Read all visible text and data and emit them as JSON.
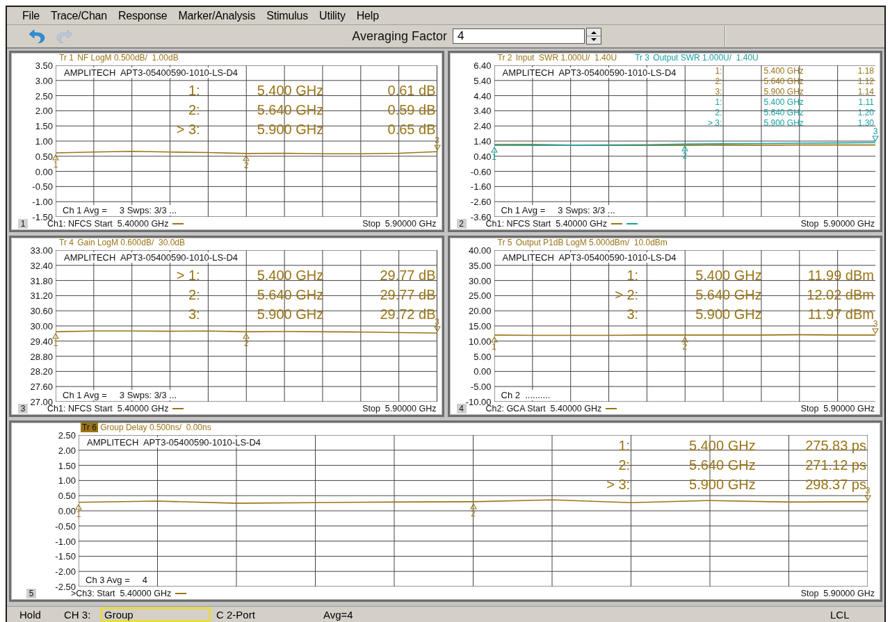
{
  "menu": [
    "File",
    "Trace/Chan",
    "Response",
    "Marker/Analysis",
    "Stimulus",
    "Utility",
    "Help"
  ],
  "toolbar": {
    "undo": {
      "disabled": false
    },
    "redo": {
      "disabled": true
    },
    "field_label": "Averaging Factor",
    "field_value": "4"
  },
  "panels": [
    {
      "number": "1",
      "traces": [
        {
          "description": "NF LogM 0.500dB/  1.00dB",
          "color": "#9a7416",
          "selected": false
        }
      ],
      "title": "AMPLITECH  APT3-05400590-1010-LS-D4",
      "readouts": [
        {
          "label": "1:",
          "frequency": "5.400 GHz",
          "value": "0.61 dB",
          "color": "#9a7416"
        },
        {
          "label": "2:",
          "frequency": "5.640 GHz",
          "value": "0.59 dB",
          "color": "#9a7416"
        },
        {
          "label": "> 3:",
          "frequency": "5.900 GHz",
          "value": "0.65 dB",
          "color": "#9a7416"
        }
      ],
      "markers": [
        {
          "text": "1"
        },
        {
          "text": "2"
        },
        {
          "text": "3"
        }
      ],
      "channel_status": "Ch 1 Avg =     3 Swps: 3/3 ...",
      "start": "Ch1: NFCS Start  5.40000 GHz",
      "stop": "Stop  5.90000 GHz",
      "chart_data": {
        "type": "line",
        "categories": [
          null,
          null,
          null,
          null,
          null,
          null,
          null,
          null,
          null,
          null,
          null
        ],
        "ylim": [
          -1.5,
          3.5
        ],
        "grid": true,
        "yticks": [
          {
            "value": 3.5,
            "label": "3.50"
          },
          {
            "value": 3,
            "label": "3.00"
          },
          {
            "value": 2.5,
            "label": "2.50"
          },
          {
            "value": 2,
            "label": "2.00"
          },
          {
            "value": 1.5,
            "label": "1.50"
          },
          {
            "value": 1,
            "label": "1.00"
          },
          {
            "value": 0.5,
            "label": "0.50"
          },
          {
            "value": 0,
            "label": "0.00"
          },
          {
            "value": -0.5,
            "label": "-0.50"
          },
          {
            "value": -1,
            "label": "-1.00"
          },
          {
            "value": -1.5,
            "label": "-1.50"
          }
        ],
        "series": [
          {
            "name": "Tr 1",
            "color": "#9a7416",
            "values": [
              0.61,
              0.64,
              0.66,
              0.64,
              0.62,
              0.59,
              0.6,
              0.58,
              0.58,
              0.6,
              0.65
            ]
          }
        ]
      }
    },
    {
      "number": "2",
      "traces": [
        {
          "description": "Input  SWR 1.000U/  1.40U",
          "color": "#9a7416",
          "selected": false
        },
        {
          "description": "Output SWR 1.000U/  1.40U",
          "color": "#1aa0a0",
          "selected": false
        }
      ],
      "title": "AMPLITECH  APT3-05400590-1010-LS-D4",
      "readouts": [
        {
          "label": "1:",
          "frequency": "5.400 GHz",
          "value": "1.18",
          "color": "#9a7416"
        },
        {
          "label": "2:",
          "frequency": "5.640 GHz",
          "value": "1.12",
          "color": "#9a7416"
        },
        {
          "label": "3:",
          "frequency": "5.900 GHz",
          "value": "1.14",
          "color": "#9a7416"
        },
        {
          "label": "1:",
          "frequency": "5.400 GHz",
          "value": "1.11",
          "color": "#1aa0a0"
        },
        {
          "label": "2:",
          "frequency": "5.640 GHz",
          "value": "1.20",
          "color": "#1aa0a0"
        },
        {
          "label": "> 3:",
          "frequency": "5.900 GHz",
          "value": "1.30",
          "color": "#1aa0a0"
        }
      ],
      "markers": [
        {
          "text": "1"
        },
        {
          "text": "2"
        },
        {
          "text": "3"
        }
      ],
      "channel_status": "Ch 1 Avg =     3 Swps: 3/3 ...",
      "start": "Ch1: NFCS Start  5.40000 GHz",
      "stop": "Stop  5.90000 GHz",
      "chart_data": {
        "type": "line",
        "categories": [
          null,
          null,
          null,
          null,
          null,
          null,
          null,
          null,
          null,
          null,
          null
        ],
        "ylim": [
          -3.6,
          6.4
        ],
        "grid": true,
        "yticks": [
          {
            "value": 6.4,
            "label": "6.40"
          },
          {
            "value": 5.4,
            "label": "5.40"
          },
          {
            "value": 4.4,
            "label": "4.40"
          },
          {
            "value": 3.4,
            "label": "3.40"
          },
          {
            "value": 2.4,
            "label": "2.40"
          },
          {
            "value": 1.4,
            "label": "1.40"
          },
          {
            "value": 0.4,
            "label": "0.40"
          },
          {
            "value": -0.6,
            "label": "-0.60"
          },
          {
            "value": -1.6,
            "label": "-1.60"
          },
          {
            "value": -2.6,
            "label": "-2.60"
          },
          {
            "value": -3.6,
            "label": "-3.60"
          }
        ],
        "series": [
          {
            "name": "Tr 2",
            "color": "#9a7416",
            "values": [
              1.18,
              1.18,
              1.13,
              1.12,
              1.12,
              1.12,
              1.13,
              1.13,
              1.14,
              1.14,
              1.14
            ]
          },
          {
            "name": "Tr 3",
            "color": "#1aa0a0",
            "values": [
              1.11,
              1.12,
              1.13,
              1.14,
              1.16,
              1.2,
              1.22,
              1.24,
              1.26,
              1.28,
              1.3
            ]
          }
        ]
      }
    },
    {
      "number": "3",
      "traces": [
        {
          "description": "Gain LogM 0.600dB/  30.0dB",
          "color": "#9a7416",
          "selected": false
        }
      ],
      "title": "AMPLITECH  APT3-05400590-1010-LS-D4",
      "readouts": [
        {
          "label": "> 1:",
          "frequency": "5.400 GHz",
          "value": "29.77 dB",
          "color": "#9a7416"
        },
        {
          "label": "2:",
          "frequency": "5.640 GHz",
          "value": "29.77 dB",
          "color": "#9a7416"
        },
        {
          "label": "3:",
          "frequency": "5.900 GHz",
          "value": "29.72 dB",
          "color": "#9a7416"
        }
      ],
      "markers": [
        {
          "text": "1"
        },
        {
          "text": "2"
        },
        {
          "text": "3"
        }
      ],
      "channel_status": "Ch 1 Avg =     3 Swps: 3/3 ...",
      "start": "Ch1: NFCS Start  5.40000 GHz",
      "stop": "Stop  5.90000 GHz",
      "chart_data": {
        "type": "line",
        "categories": [
          null,
          null,
          null,
          null,
          null,
          null,
          null,
          null,
          null,
          null,
          null
        ],
        "ylim": [
          27,
          33
        ],
        "grid": true,
        "yticks": [
          {
            "value": 33,
            "label": "33.00"
          },
          {
            "value": 32.4,
            "label": "32.40"
          },
          {
            "value": 31.8,
            "label": "31.80"
          },
          {
            "value": 31.2,
            "label": "31.20"
          },
          {
            "value": 30.6,
            "label": "30.60"
          },
          {
            "value": 30,
            "label": "30.00"
          },
          {
            "value": 29.4,
            "label": "29.40"
          },
          {
            "value": 28.8,
            "label": "28.80"
          },
          {
            "value": 28.2,
            "label": "28.20"
          },
          {
            "value": 27.6,
            "label": "27.60"
          },
          {
            "value": 27,
            "label": "27.00"
          }
        ],
        "series": [
          {
            "name": "Tr 4",
            "color": "#9a7416",
            "values": [
              29.77,
              29.8,
              29.8,
              29.79,
              29.8,
              29.77,
              29.78,
              29.77,
              29.76,
              29.74,
              29.72
            ]
          }
        ]
      }
    },
    {
      "number": "4",
      "traces": [
        {
          "description": "Output P1dB LogM 5.000dBm/  10.0dBm",
          "color": "#9a7416",
          "selected": false
        }
      ],
      "title": "AMPLITECH  APT3-05400590-1010-LS-D4",
      "readouts": [
        {
          "label": "1:",
          "frequency": "5.400 GHz",
          "value": "11.99 dBm",
          "color": "#9a7416"
        },
        {
          "label": "> 2:",
          "frequency": "5.640 GHz",
          "value": "12.02 dBm",
          "color": "#9a7416"
        },
        {
          "label": "3:",
          "frequency": "5.900 GHz",
          "value": "11.97 dBm",
          "color": "#9a7416"
        }
      ],
      "markers": [
        {
          "text": "1"
        },
        {
          "text": "2"
        },
        {
          "text": "3"
        }
      ],
      "channel_status": "Ch 2  ..........",
      "start": "Ch2: GCA Start  5.40000 GHz",
      "stop": "Stop  5.90000 GHz",
      "chart_data": {
        "type": "line",
        "categories": [
          null,
          null,
          null,
          null,
          null,
          null,
          null,
          null,
          null,
          null,
          null
        ],
        "ylim": [
          -10,
          40
        ],
        "grid": true,
        "yticks": [
          {
            "value": 40,
            "label": "40.00"
          },
          {
            "value": 35,
            "label": "35.00"
          },
          {
            "value": 30,
            "label": "30.00"
          },
          {
            "value": 25,
            "label": "25.00"
          },
          {
            "value": 20,
            "label": "20.00"
          },
          {
            "value": 15,
            "label": "15.00"
          },
          {
            "value": 10,
            "label": "10.00"
          },
          {
            "value": 5,
            "label": "5.00"
          },
          {
            "value": 0,
            "label": "0.00"
          },
          {
            "value": -5,
            "label": "-5.00"
          },
          {
            "value": -10,
            "label": "-10.00"
          }
        ],
        "series": [
          {
            "name": "Tr 5",
            "color": "#9a7416",
            "values": [
              12.0,
              11.9,
              11.9,
              11.9,
              12.0,
              12.0,
              12.0,
              12.0,
              12.1,
              12.0,
              12.0
            ]
          }
        ]
      }
    },
    {
      "number": "5",
      "traces": [
        {
          "description": "Group Delay 0.500ns/  0.00ns",
          "color": "#9a7416",
          "selected": true
        }
      ],
      "title": "AMPLITECH  APT3-05400590-1010-LS-D4",
      "readouts": [
        {
          "label": "1:",
          "frequency": "5.400 GHz",
          "value": "275.83 ps",
          "color": "#9a7416"
        },
        {
          "label": "2:",
          "frequency": "5.640 GHz",
          "value": "271.12 ps",
          "color": "#9a7416"
        },
        {
          "label": "> 3:",
          "frequency": "5.900 GHz",
          "value": "298.37 ps",
          "color": "#9a7416"
        }
      ],
      "markers": [
        {
          "text": "1"
        },
        {
          "text": "2"
        },
        {
          "text": "3"
        }
      ],
      "channel_status": "Ch 3 Avg =     4",
      "start": ">Ch3: Start  5.40000 GHz",
      "stop": "Stop  5.90000 GHz",
      "chart_data": {
        "type": "line",
        "categories": [
          null,
          null,
          null,
          null,
          null,
          null,
          null,
          null,
          null,
          null,
          null
        ],
        "ylim": [
          -2.5,
          2.5
        ],
        "grid": true,
        "yticks": [
          {
            "value": 2.5,
            "label": "2.50"
          },
          {
            "value": 2,
            "label": "2.00"
          },
          {
            "value": 1.5,
            "label": "1.50"
          },
          {
            "value": 1,
            "label": "1.00"
          },
          {
            "value": 0.5,
            "label": "0.50"
          },
          {
            "value": 0,
            "label": "0.00"
          },
          {
            "value": -0.5,
            "label": "-0.50"
          },
          {
            "value": -1,
            "label": "-1.00"
          },
          {
            "value": -1.5,
            "label": "-1.50"
          },
          {
            "value": -2,
            "label": "-2.00"
          },
          {
            "value": -2.5,
            "label": "-2.50"
          }
        ],
        "series": [
          {
            "name": "Tr 6",
            "color": "#9a7416",
            "values": [
              0.28,
              0.32,
              0.25,
              0.27,
              0.29,
              0.3,
              0.36,
              0.27,
              0.34,
              0.29,
              0.3
            ]
          }
        ]
      }
    }
  ],
  "status_bar": [
    {
      "text": "Hold",
      "kind": "text"
    },
    {
      "text": "CH 3:",
      "kind": "text"
    },
    {
      "text": "Group",
      "kind": "field"
    },
    {
      "text": "C 2-Port",
      "kind": "text"
    },
    {
      "text": "Avg=4",
      "kind": "text"
    },
    {
      "text": "LCL",
      "kind": "text"
    }
  ]
}
